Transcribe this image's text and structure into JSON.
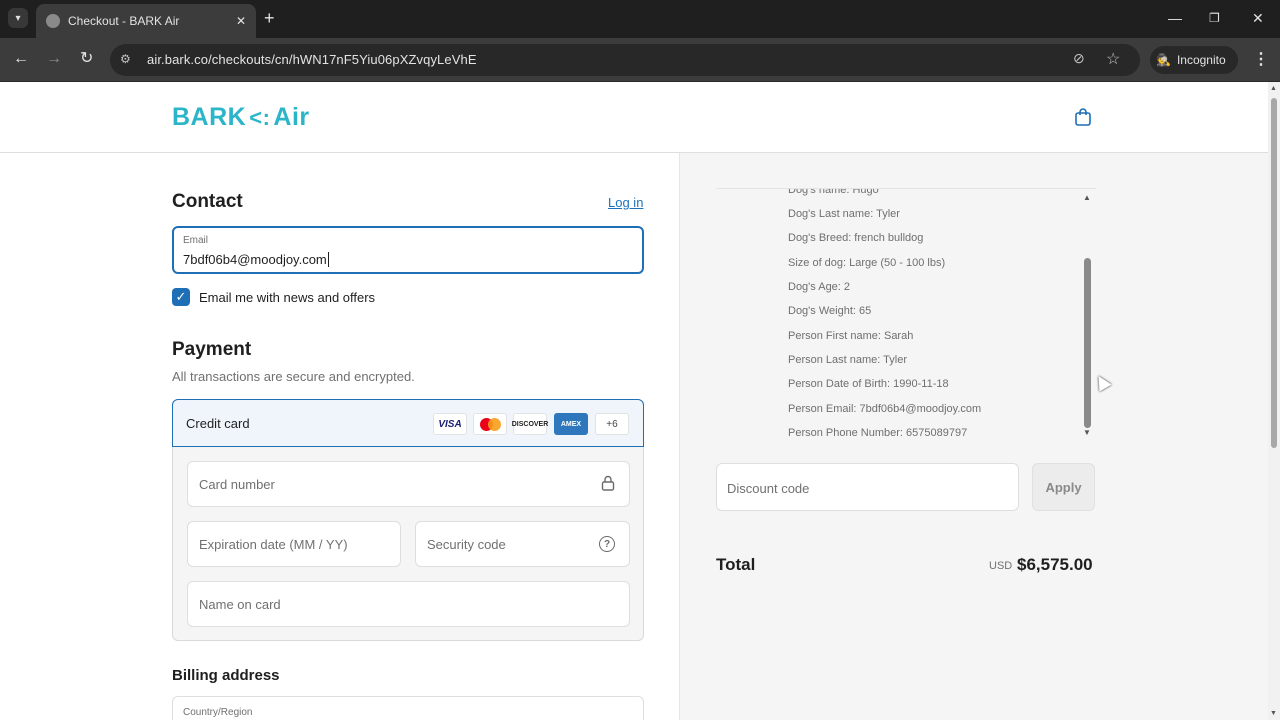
{
  "browser": {
    "tab_title": "Checkout - BARK Air",
    "tab_close": "✕",
    "new_tab": "+",
    "url": "air.bark.co/checkouts/cn/hWN17nF5Yiu06pXZvqyLeVhE",
    "incognito_label": "Incognito",
    "window_controls": [
      "—",
      "❐",
      "✕"
    ]
  },
  "header": {
    "logo_left": "BARK",
    "logo_mark": "<:",
    "logo_right": "Air"
  },
  "contact": {
    "title": "Contact",
    "login_link": "Log in",
    "email_label": "Email",
    "email_value": "7bdf06b4@moodjoy.com",
    "newsletter_label": "Email me with news and offers",
    "newsletter_checked": true
  },
  "payment": {
    "title": "Payment",
    "subtitle": "All transactions are secure and encrypted.",
    "method_label": "Credit card",
    "brands": [
      "VISA",
      "DISCOVER",
      "AMEX"
    ],
    "more_brands": "+6",
    "card_number_placeholder": "Card number",
    "expiration_placeholder": "Expiration date (MM / YY)",
    "security_placeholder": "Security code",
    "name_placeholder": "Name on card"
  },
  "billing": {
    "title": "Billing address",
    "country_label": "Country/Region"
  },
  "order": {
    "details": [
      "Dog's name: Hugo",
      "Dog's Last name: Tyler",
      "Dog's Breed: french bulldog",
      "Size of dog: Large (50 - 100 lbs)",
      "Dog's Age: 2",
      "Dog's Weight: 65",
      "Person First name: Sarah",
      "Person Last name: Tyler",
      "Person Date of Birth: 1990-11-18",
      "Person Email: 7bdf06b4@moodjoy.com",
      "Person Phone Number: 6575089797"
    ],
    "discount_placeholder": "Discount code",
    "apply_label": "Apply",
    "total_label": "Total",
    "currency": "USD",
    "total_value": "$6,575.00"
  },
  "colors": {
    "brand": "#2bb5c9",
    "accent": "#1f6fb6"
  }
}
